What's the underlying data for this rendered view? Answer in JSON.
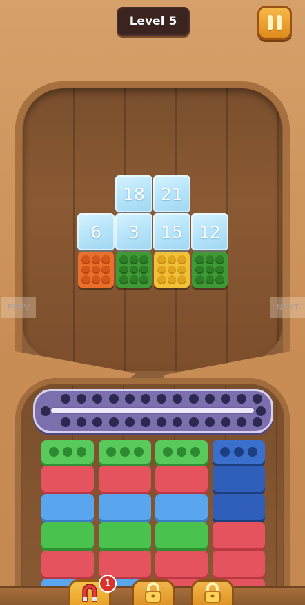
{
  "header": {
    "level_label": "Level 5",
    "pause_icon": "pause-icon"
  },
  "nav": {
    "prev_label": "PREV",
    "next_label": "NEXT"
  },
  "board": {
    "ice_tiles": [
      {
        "value": "18"
      },
      {
        "value": "21"
      },
      {
        "value": "6"
      },
      {
        "value": "3"
      },
      {
        "value": "15"
      },
      {
        "value": "12"
      }
    ],
    "blocks": [
      {
        "color": "orange"
      },
      {
        "color": "green"
      },
      {
        "color": "yellow"
      },
      {
        "color": "green"
      }
    ]
  },
  "stacks": {
    "columns": [
      {
        "top": "green",
        "pieces": [
          "red",
          "blue",
          "green",
          "red",
          "blue"
        ]
      },
      {
        "top": "green",
        "pieces": [
          "red",
          "blue",
          "green",
          "red",
          "blue"
        ]
      },
      {
        "top": "green",
        "pieces": [
          "red",
          "blue",
          "green",
          "red",
          "red"
        ]
      },
      {
        "top": "navy",
        "pieces": [
          "navy",
          "navy",
          "red",
          "red",
          "red"
        ]
      }
    ]
  },
  "boosters": {
    "magnet_count": "1",
    "magnet_icon": "magnet-icon",
    "lock_icon": "lock-icon"
  },
  "colors": {
    "background": "#cf9a63",
    "board_wood": "#7a4f2d",
    "conveyor": "#7b6fae",
    "level_badge": "#3b2420",
    "pause_button": "#f0a838"
  }
}
